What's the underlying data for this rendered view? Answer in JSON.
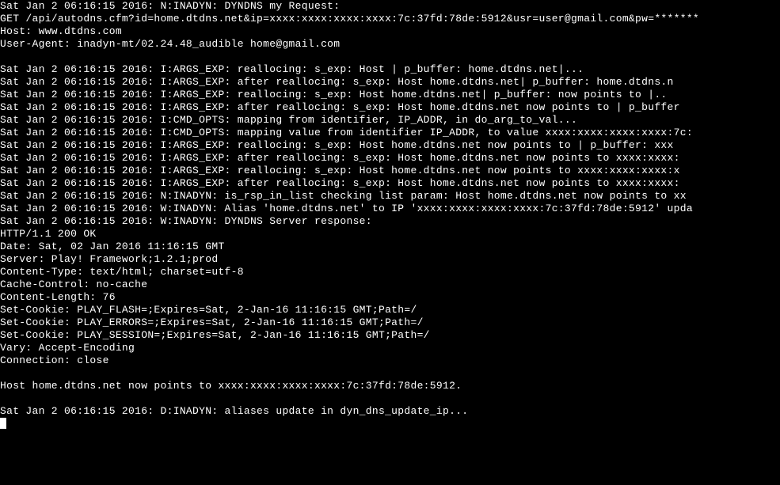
{
  "lines": [
    "Sat Jan  2 06:16:15 2016: N:INADYN: DYNDNS my Request:",
    "GET /api/autodns.cfm?id=home.dtdns.net&ip=xxxx:xxxx:xxxx:xxxx:7c:37fd:78de:5912&usr=user@gmail.com&pw=*******",
    "Host: www.dtdns.com",
    "User-Agent: inadyn-mt/02.24.48_audible home@gmail.com",
    "",
    "Sat Jan  2 06:16:15 2016: I:ARGS_EXP: reallocing:  s_exp:  Host | p_buffer:  home.dtdns.net|...",
    "Sat Jan  2 06:16:15 2016: I:ARGS_EXP: after reallocing:  s_exp:  Host home.dtdns.net| p_buffer:  home.dtdns.n",
    "Sat Jan  2 06:16:15 2016: I:ARGS_EXP: reallocing:  s_exp:  Host home.dtdns.net| p_buffer:   now points to |..",
    "Sat Jan  2 06:16:15 2016: I:ARGS_EXP: after reallocing:  s_exp:  Host home.dtdns.net now points to | p_buffer",
    "Sat Jan  2 06:16:15 2016: I:CMD_OPTS: mapping from identifier, IP_ADDR, in do_arg_to_val...",
    "Sat Jan  2 06:16:15 2016: I:CMD_OPTS: mapping value from identifier IP_ADDR, to value xxxx:xxxx:xxxx:xxxx:7c:",
    "Sat Jan  2 06:16:15 2016: I:ARGS_EXP: reallocing:  s_exp:  Host home.dtdns.net now points to | p_buffer:  xxx",
    "Sat Jan  2 06:16:15 2016: I:ARGS_EXP: after reallocing:  s_exp:  Host home.dtdns.net now points to xxxx:xxxx:",
    "Sat Jan  2 06:16:15 2016: I:ARGS_EXP: reallocing:  s_exp:  Host home.dtdns.net now points to xxxx:xxxx:xxxx:x",
    "Sat Jan  2 06:16:15 2016: I:ARGS_EXP: after reallocing:  s_exp:  Host home.dtdns.net now points to xxxx:xxxx:",
    "Sat Jan  2 06:16:15 2016: N:INADYN: is_rsp_in_list checking list param:  Host home.dtdns.net now points to xx",
    "Sat Jan  2 06:16:15 2016: W:INADYN: Alias 'home.dtdns.net' to IP 'xxxx:xxxx:xxxx:xxxx:7c:37fd:78de:5912' upda",
    "Sat Jan  2 06:16:15 2016: W:INADYN: DYNDNS Server response:",
    "HTTP/1.1 200 OK",
    "Date: Sat, 02 Jan 2016 11:16:15 GMT",
    "Server: Play! Framework;1.2.1;prod",
    "Content-Type: text/html; charset=utf-8",
    "Cache-Control: no-cache",
    "Content-Length: 76",
    "Set-Cookie: PLAY_FLASH=;Expires=Sat, 2-Jan-16 11:16:15 GMT;Path=/",
    "Set-Cookie: PLAY_ERRORS=;Expires=Sat, 2-Jan-16 11:16:15 GMT;Path=/",
    "Set-Cookie: PLAY_SESSION=;Expires=Sat, 2-Jan-16 11:16:15 GMT;Path=/",
    "Vary: Accept-Encoding",
    "Connection: close",
    "",
    "Host home.dtdns.net now points to xxxx:xxxx:xxxx:xxxx:7c:37fd:78de:5912.",
    "",
    "Sat Jan  2 06:16:15 2016: D:INADYN: aliases update in dyn_dns_update_ip..."
  ]
}
